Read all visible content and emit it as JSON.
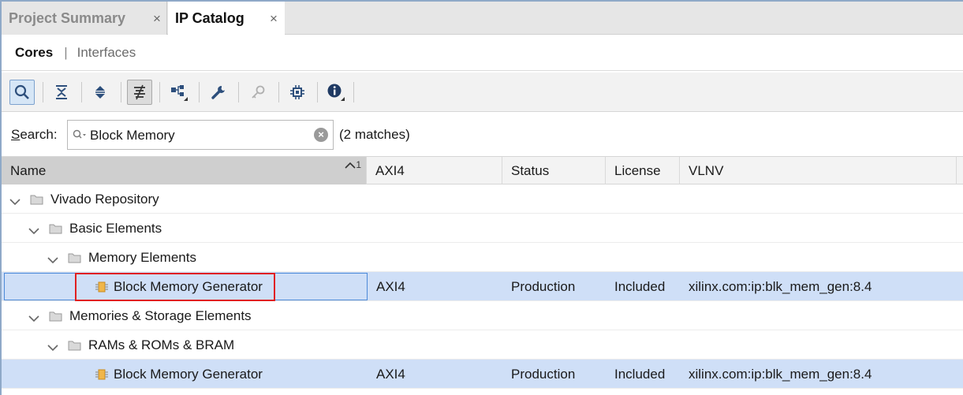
{
  "tabs": [
    {
      "label": "Project Summary",
      "active": false,
      "close": "×"
    },
    {
      "label": "IP Catalog",
      "active": true,
      "close": "×"
    }
  ],
  "subtabs": {
    "cores": "Cores",
    "separator": "|",
    "interfaces": "Interfaces"
  },
  "toolbar": {
    "buttons": [
      {
        "icon": "search-icon",
        "pressed": true
      },
      {
        "icon": "collapse-all-icon",
        "pressed": false
      },
      {
        "icon": "expand-all-icon",
        "pressed": false
      },
      {
        "icon": "filter-toggle-icon",
        "pressed": true
      },
      {
        "icon": "hierarchy-icon",
        "pressed": false
      },
      {
        "icon": "wrench-icon",
        "pressed": false
      },
      {
        "icon": "key-icon",
        "pressed": false,
        "disabled": true
      },
      {
        "icon": "chip-icon",
        "pressed": false
      },
      {
        "icon": "info-icon",
        "pressed": false
      }
    ]
  },
  "search": {
    "label_underlined": "S",
    "label_rest": "earch:",
    "value": "Block Memory",
    "placeholder": "",
    "matches": "(2 matches)"
  },
  "table": {
    "columns": [
      "Name",
      "AXI4",
      "Status",
      "License",
      "VLNV"
    ],
    "sort_indicator": "1",
    "rows": [
      {
        "level": 0,
        "type": "folder",
        "label": "Vivado Repository",
        "axi4": "",
        "status": "",
        "license": "",
        "vlnv": ""
      },
      {
        "level": 1,
        "type": "folder",
        "label": "Basic Elements",
        "axi4": "",
        "status": "",
        "license": "",
        "vlnv": ""
      },
      {
        "level": 2,
        "type": "folder",
        "label": "Memory Elements",
        "axi4": "",
        "status": "",
        "license": "",
        "vlnv": ""
      },
      {
        "level": 3,
        "type": "ip",
        "label": "Block Memory Generator",
        "axi4": "AXI4",
        "status": "Production",
        "license": "Included",
        "vlnv": "xilinx.com:ip:blk_mem_gen:8.4"
      },
      {
        "level": 1,
        "type": "folder",
        "label": "Memories & Storage Elements",
        "axi4": "",
        "status": "",
        "license": "",
        "vlnv": ""
      },
      {
        "level": 2,
        "type": "folder",
        "label": "RAMs & ROMs & BRAM",
        "axi4": "",
        "status": "",
        "license": "",
        "vlnv": ""
      },
      {
        "level": 3,
        "type": "ip",
        "label": "Block Memory Generator",
        "axi4": "AXI4",
        "status": "Production",
        "license": "Included",
        "vlnv": "xilinx.com:ip:blk_mem_gen:8.4"
      }
    ]
  },
  "colors": {
    "selection": "#cfdff7",
    "highlight_box": "#e02020",
    "focus": "#4d8ad8"
  }
}
